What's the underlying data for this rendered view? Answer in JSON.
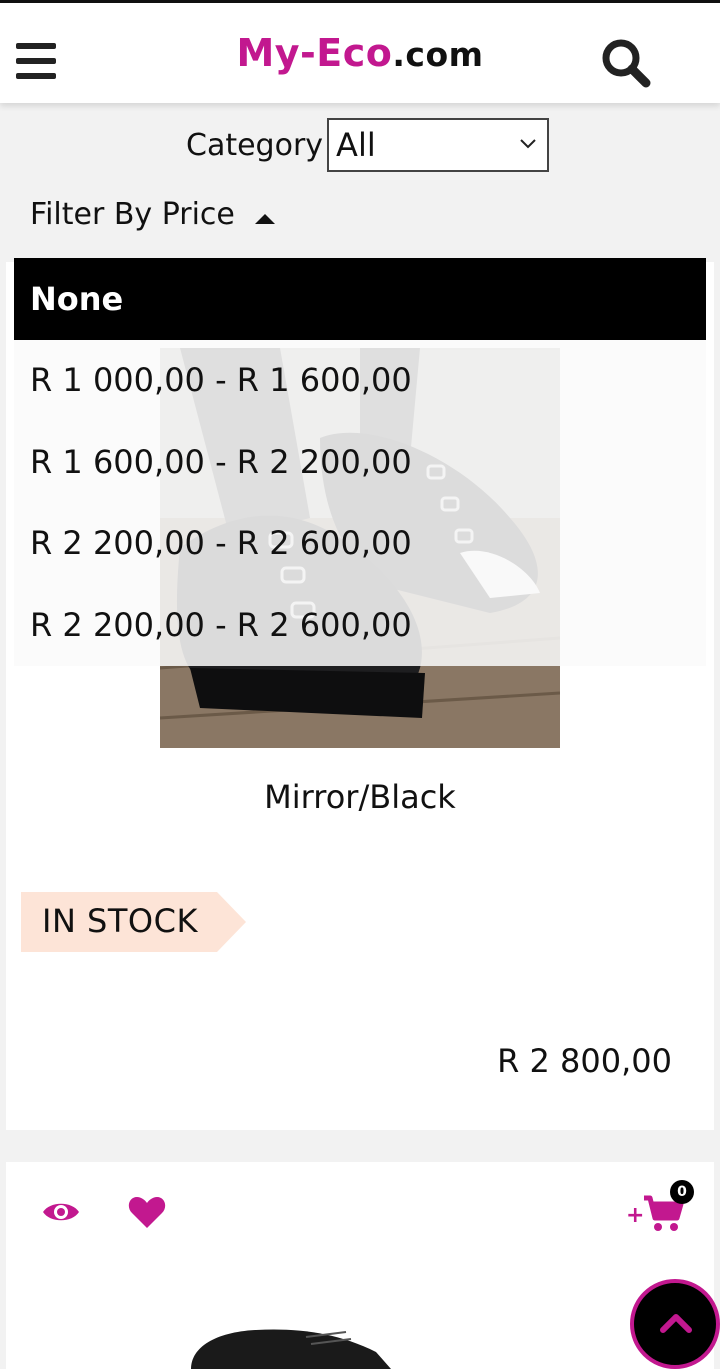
{
  "header": {
    "brand_part1": "My-Eco",
    "brand_part2": ".com",
    "menu_icon": "hamburger-menu-icon",
    "search_icon": "search-icon"
  },
  "category": {
    "label": "Category",
    "selected": "All"
  },
  "filter": {
    "label": "Filter By Price",
    "dropdown": {
      "selected": "None",
      "options": [
        "R 1 000,00 - R 1 600,00",
        "R 1 600,00 - R 2 200,00",
        "R 2 200,00 - R 2 600,00",
        "R 2 200,00 - R 2 600,00"
      ]
    }
  },
  "products": [
    {
      "name": "Mirror/Black",
      "stock": "IN STOCK",
      "price": "R 2 800,00"
    }
  ],
  "card2": {
    "cart_count": "0",
    "icons": [
      "eye-icon",
      "heart-icon",
      "add-to-cart-icon"
    ]
  },
  "colors": {
    "brand": "#c2188f",
    "stock_tag": "#fde4d7",
    "dropdown_selected_bg": "#000000"
  }
}
